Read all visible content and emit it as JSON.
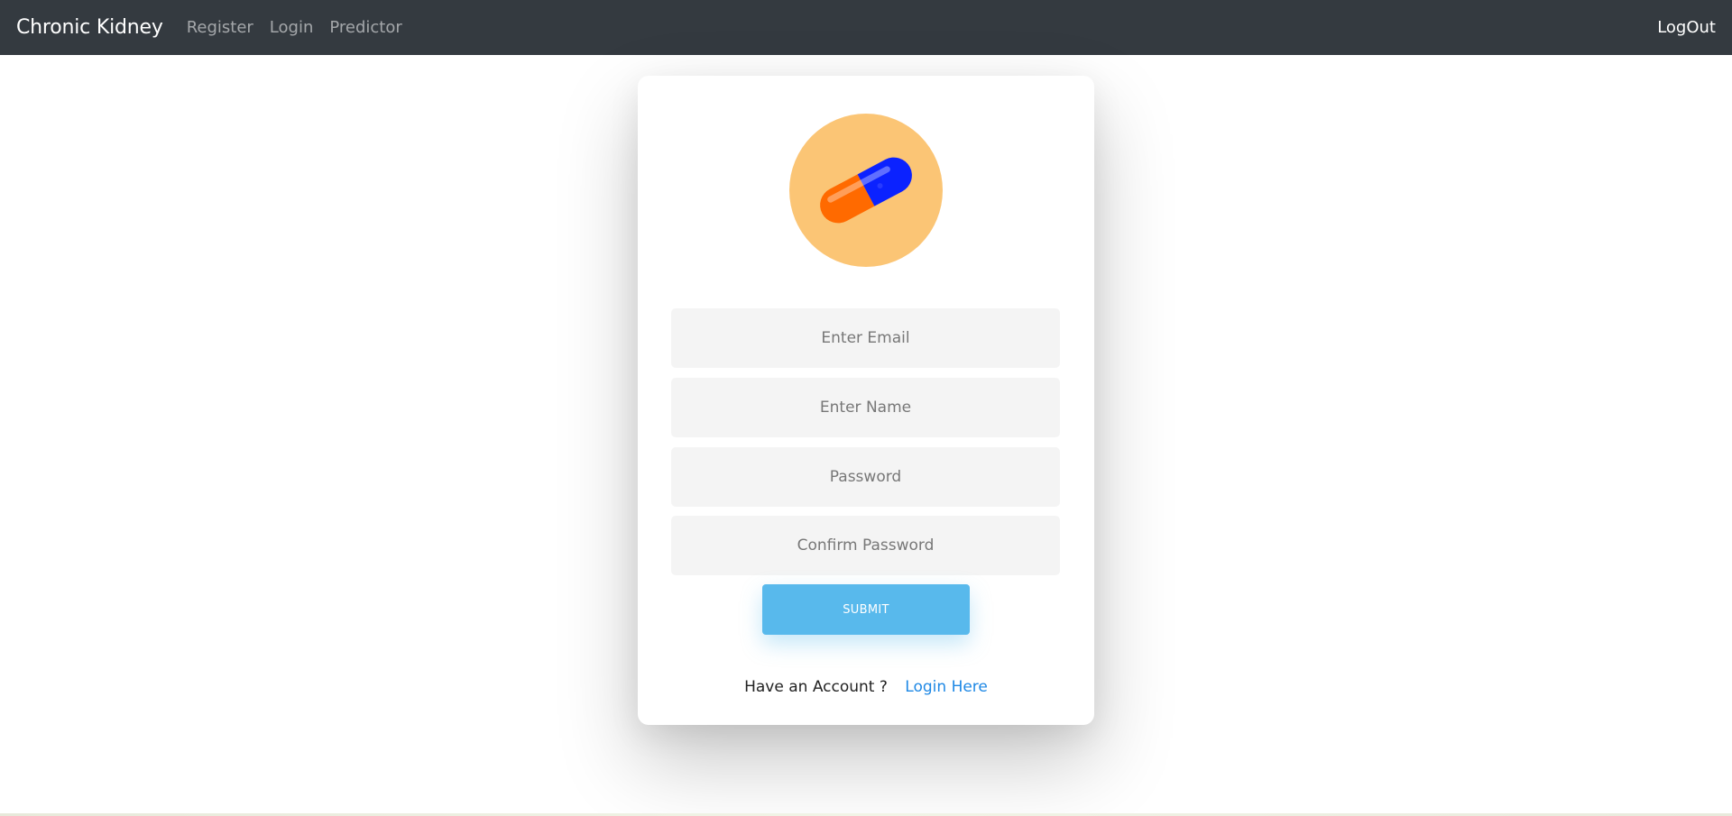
{
  "navbar": {
    "brand": "Chronic Kidney",
    "links": [
      "Register",
      "Login",
      "Predictor"
    ],
    "right_link": "LogOut"
  },
  "form": {
    "logo_icon": "capsule-icon",
    "email_placeholder": "Enter Email",
    "name_placeholder": "Enter Name",
    "password_placeholder": "Password",
    "confirm_password_placeholder": "Confirm Password",
    "submit_label": "SUBMIT",
    "account_text": "Have an Account ?",
    "login_link": "Login Here"
  },
  "colors": {
    "navbar_bg": "#343a40",
    "logo_circle": "#fbc575",
    "capsule_orange": "#ff6a00",
    "capsule_blue": "#0b22ff",
    "submit_bg": "#58b9ec",
    "link": "#1e88e5",
    "field_bg": "#f4f4f4"
  }
}
